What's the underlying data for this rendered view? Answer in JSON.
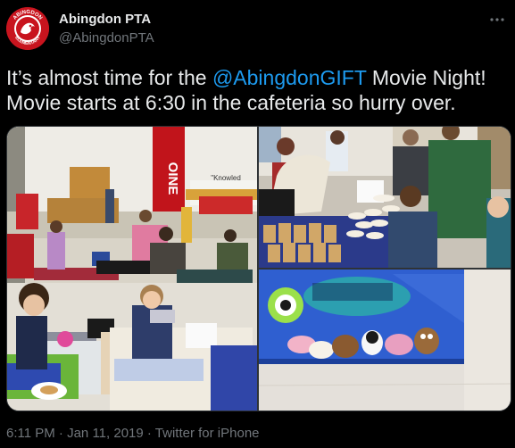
{
  "author": {
    "name": "Abingdon PTA",
    "handle": "@AbingdonPTA",
    "avatar_text": "ABINGDON ELEMENTARY"
  },
  "more_icon": "ellipsis-icon",
  "text": {
    "part1": "It’s almost time for the ",
    "mention": "@AbingdonGIFT",
    "part2": " Movie Night! Movie starts at 6:30 in the cafeteria so hurry over."
  },
  "photos": [
    {
      "banner": "OINE",
      "poster": "\"Knowled"
    },
    {},
    {}
  ],
  "meta": {
    "time": "6:11 PM",
    "sep1": " · ",
    "date": "Jan 11, 2019",
    "sep2": " · ",
    "source": "Twitter for iPhone"
  },
  "colors": {
    "background": "#000000",
    "text": "#e7e9ea",
    "muted": "#71767b",
    "accent": "#1d9bf0",
    "avatar_red": "#c8141e"
  }
}
